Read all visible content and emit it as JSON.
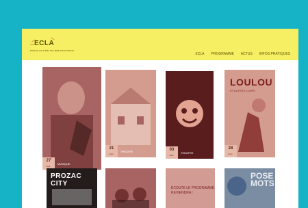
{
  "brand": {
    "name": "ECLA",
    "tagline": "ESPACE CULTUREL DE LIBRE AFFECTATION",
    "accent": "#f7ef63"
  },
  "nav": {
    "items": [
      {
        "label": "ECLA"
      },
      {
        "label": "PROGRAMME"
      },
      {
        "label": "ACTUS"
      },
      {
        "label": "INFOS PRATIQUES"
      }
    ]
  },
  "cards": [
    {
      "name": "vivaldi",
      "date_day": "27",
      "date_month": "Févr.",
      "label": "MUSIQUE",
      "color": "#a86463"
    },
    {
      "name": "house",
      "date_day": "21",
      "date_month": "Févr.",
      "label": "THEATRE",
      "color": "#d49c8f"
    },
    {
      "name": "tiger",
      "date_day": "03",
      "date_month": "Févr.",
      "label": "THEATRE",
      "color": "#5a1d1d"
    },
    {
      "name": "loulou",
      "title": "LOULOU",
      "subtitle": "ET AUTRES LOUPS",
      "date_day": "28",
      "date_month": "Févr.",
      "label": "",
      "color": "#d49c8f"
    },
    {
      "name": "prozac",
      "title": "PROZAC CITY",
      "color": "#241b1b"
    },
    {
      "name": "musicians",
      "color": "#a86463"
    },
    {
      "name": "text-card",
      "text": "ÉCOUTE LE PROGRAMME REVIENDRA !",
      "color": "#d29c95"
    },
    {
      "name": "pose",
      "title": "POSE MOTS",
      "color": "#7b8da3"
    }
  ]
}
